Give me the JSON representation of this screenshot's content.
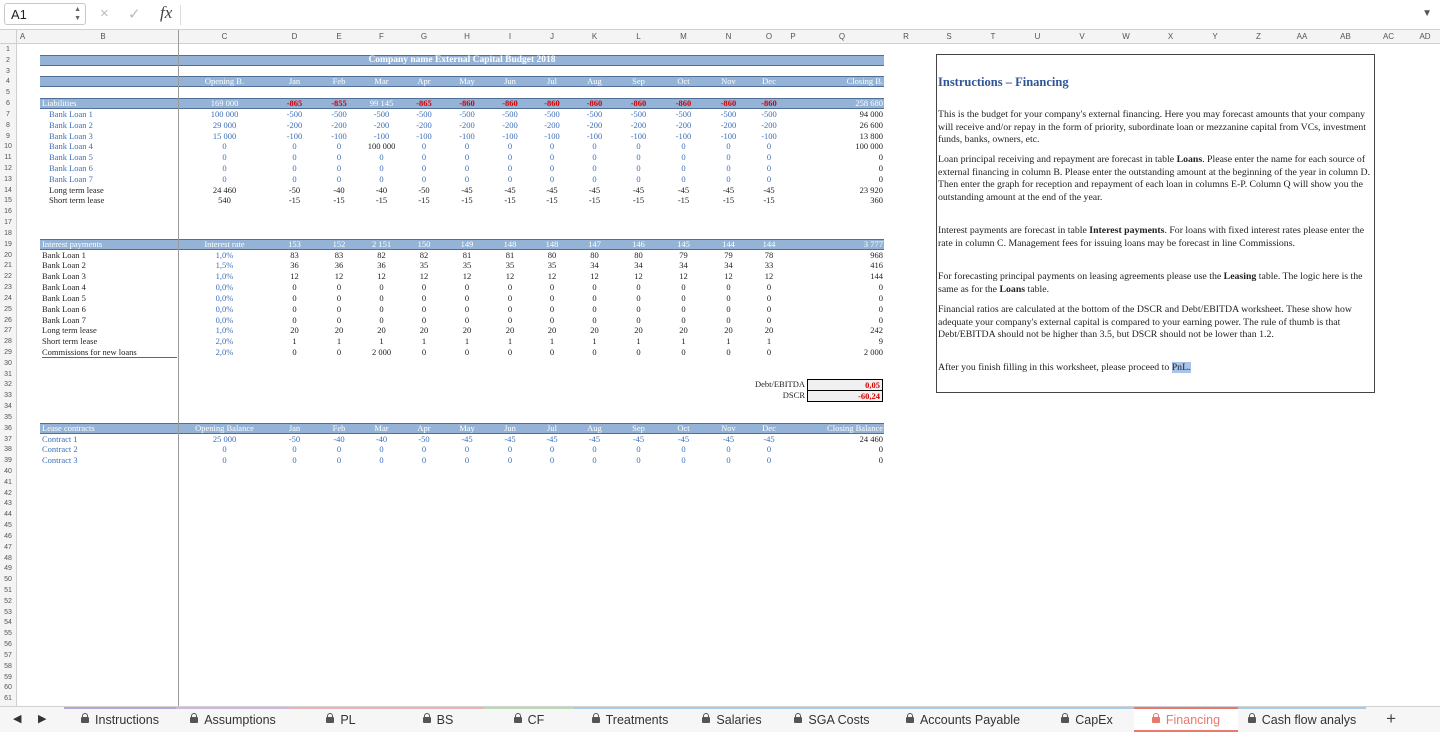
{
  "formula_bar": {
    "cell_ref": "A1",
    "cancel_icon": "×",
    "confirm_icon": "✓",
    "fx_label": "fx",
    "formula": ""
  },
  "columns": [
    "A",
    "B",
    "C",
    "D",
    "E",
    "F",
    "G",
    "H",
    "I",
    "J",
    "K",
    "L",
    "M",
    "N",
    "O",
    "P",
    "Q",
    "R",
    "S",
    "T",
    "U",
    "V",
    "W",
    "X",
    "Y",
    "Z",
    "AA",
    "AB",
    "AC",
    "AD"
  ],
  "rows": [
    "1",
    "2",
    "3",
    "4",
    "5",
    "6",
    "7",
    "8",
    "9",
    "10",
    "11",
    "12",
    "13",
    "14",
    "15",
    "16",
    "17",
    "18",
    "19",
    "20",
    "21",
    "22",
    "23",
    "24",
    "25",
    "26",
    "27",
    "28",
    "29",
    "30",
    "31",
    "32",
    "33",
    "34",
    "35",
    "36",
    "37",
    "38",
    "39",
    "40",
    "41",
    "42",
    "43",
    "44",
    "45",
    "46",
    "47",
    "48",
    "49",
    "50",
    "51",
    "52",
    "53",
    "54",
    "55",
    "56",
    "57",
    "58",
    "59",
    "60",
    "61"
  ],
  "title": "Company name External Capital Budget 2018",
  "months": [
    "Jan",
    "Feb",
    "Mar",
    "Apr",
    "May",
    "Jun",
    "Jul",
    "Aug",
    "Sep",
    "Oct",
    "Nov",
    "Dec"
  ],
  "liabilities": {
    "opening_label": "Opening B.",
    "closing_label": "Closing B.",
    "header": {
      "name": "Liabilities",
      "opening": "169 000",
      "months": [
        "-865",
        "-855",
        "99 145",
        "-865",
        "-860",
        "-860",
        "-860",
        "-860",
        "-860",
        "-860",
        "-860",
        "-860"
      ],
      "closing": "258 680"
    },
    "rows": [
      {
        "name": "Bank Loan 1",
        "opening": "100 000",
        "months": [
          "-500",
          "-500",
          "-500",
          "-500",
          "-500",
          "-500",
          "-500",
          "-500",
          "-500",
          "-500",
          "-500",
          "-500"
        ],
        "closing": "94 000"
      },
      {
        "name": "Bank Loan 2",
        "opening": "29 000",
        "months": [
          "-200",
          "-200",
          "-200",
          "-200",
          "-200",
          "-200",
          "-200",
          "-200",
          "-200",
          "-200",
          "-200",
          "-200"
        ],
        "closing": "26 600"
      },
      {
        "name": "Bank Loan 3",
        "opening": "15 000",
        "months": [
          "-100",
          "-100",
          "-100",
          "-100",
          "-100",
          "-100",
          "-100",
          "-100",
          "-100",
          "-100",
          "-100",
          "-100"
        ],
        "closing": "13 800"
      },
      {
        "name": "Bank Loan 4",
        "opening": "0",
        "months": [
          "0",
          "0",
          "100 000",
          "0",
          "0",
          "0",
          "0",
          "0",
          "0",
          "0",
          "0",
          "0"
        ],
        "closing": "100 000"
      },
      {
        "name": "Bank Loan 5",
        "opening": "0",
        "months": [
          "0",
          "0",
          "0",
          "0",
          "0",
          "0",
          "0",
          "0",
          "0",
          "0",
          "0",
          "0"
        ],
        "closing": "0"
      },
      {
        "name": "Bank Loan 6",
        "opening": "0",
        "months": [
          "0",
          "0",
          "0",
          "0",
          "0",
          "0",
          "0",
          "0",
          "0",
          "0",
          "0",
          "0"
        ],
        "closing": "0"
      },
      {
        "name": "Bank Loan 7",
        "opening": "0",
        "months": [
          "0",
          "0",
          "0",
          "0",
          "0",
          "0",
          "0",
          "0",
          "0",
          "0",
          "0",
          "0"
        ],
        "closing": "0"
      },
      {
        "name": "Long term lease",
        "opening": "24 460",
        "months": [
          "-50",
          "-40",
          "-40",
          "-50",
          "-45",
          "-45",
          "-45",
          "-45",
          "-45",
          "-45",
          "-45",
          "-45"
        ],
        "closing": "23 920"
      },
      {
        "name": "Short term lease",
        "opening": "540",
        "months": [
          "-15",
          "-15",
          "-15",
          "-15",
          "-15",
          "-15",
          "-15",
          "-15",
          "-15",
          "-15",
          "-15",
          "-15"
        ],
        "closing": "360"
      }
    ]
  },
  "interest": {
    "header": {
      "name": "Interest payments",
      "rate": "Interest rate",
      "months": [
        "153",
        "152",
        "2 151",
        "150",
        "149",
        "148",
        "148",
        "147",
        "146",
        "145",
        "144",
        "144"
      ],
      "closing": "3 777"
    },
    "rows": [
      {
        "name": "Bank Loan 1",
        "rate": "1,0%",
        "months": [
          "83",
          "83",
          "82",
          "82",
          "81",
          "81",
          "80",
          "80",
          "80",
          "79",
          "79",
          "78"
        ],
        "closing": "968"
      },
      {
        "name": "Bank Loan 2",
        "rate": "1,5%",
        "months": [
          "36",
          "36",
          "36",
          "35",
          "35",
          "35",
          "35",
          "34",
          "34",
          "34",
          "34",
          "33"
        ],
        "closing": "416"
      },
      {
        "name": "Bank Loan 3",
        "rate": "1,0%",
        "months": [
          "12",
          "12",
          "12",
          "12",
          "12",
          "12",
          "12",
          "12",
          "12",
          "12",
          "12",
          "12"
        ],
        "closing": "144"
      },
      {
        "name": "Bank Loan 4",
        "rate": "0,0%",
        "months": [
          "0",
          "0",
          "0",
          "0",
          "0",
          "0",
          "0",
          "0",
          "0",
          "0",
          "0",
          "0"
        ],
        "closing": "0"
      },
      {
        "name": "Bank Loan 5",
        "rate": "0,0%",
        "months": [
          "0",
          "0",
          "0",
          "0",
          "0",
          "0",
          "0",
          "0",
          "0",
          "0",
          "0",
          "0"
        ],
        "closing": "0"
      },
      {
        "name": "Bank Loan 6",
        "rate": "0,0%",
        "months": [
          "0",
          "0",
          "0",
          "0",
          "0",
          "0",
          "0",
          "0",
          "0",
          "0",
          "0",
          "0"
        ],
        "closing": "0"
      },
      {
        "name": "Bank Loan 7",
        "rate": "0,0%",
        "months": [
          "0",
          "0",
          "0",
          "0",
          "0",
          "0",
          "0",
          "0",
          "0",
          "0",
          "0",
          "0"
        ],
        "closing": "0"
      },
      {
        "name": "Long term lease",
        "rate": "1,0%",
        "months": [
          "20",
          "20",
          "20",
          "20",
          "20",
          "20",
          "20",
          "20",
          "20",
          "20",
          "20",
          "20"
        ],
        "closing": "242"
      },
      {
        "name": "Short term lease",
        "rate": "2,0%",
        "months": [
          "1",
          "1",
          "1",
          "1",
          "1",
          "1",
          "1",
          "1",
          "1",
          "1",
          "1",
          "1"
        ],
        "closing": "9"
      },
      {
        "name": "Commissions for new loans",
        "rate": "2,0%",
        "months": [
          "0",
          "0",
          "2 000",
          "0",
          "0",
          "0",
          "0",
          "0",
          "0",
          "0",
          "0",
          "0"
        ],
        "closing": "2 000"
      }
    ]
  },
  "ratios": [
    {
      "label": "Debt/EBITDA",
      "value": "0,05"
    },
    {
      "label": "DSCR",
      "value": "-60,24"
    }
  ],
  "lease": {
    "header": {
      "name": "Lease contracts",
      "opening": "Opening Balance",
      "closing": "Closing Balance"
    },
    "rows": [
      {
        "name": "Contract 1",
        "opening": "25 000",
        "months": [
          "-50",
          "-40",
          "-40",
          "-50",
          "-45",
          "-45",
          "-45",
          "-45",
          "-45",
          "-45",
          "-45",
          "-45"
        ],
        "closing": "24 460"
      },
      {
        "name": "Contract 2",
        "opening": "0",
        "months": [
          "0",
          "0",
          "0",
          "0",
          "0",
          "0",
          "0",
          "0",
          "0",
          "0",
          "0",
          "0"
        ],
        "closing": "0"
      },
      {
        "name": "Contract 3",
        "opening": "0",
        "months": [
          "0",
          "0",
          "0",
          "0",
          "0",
          "0",
          "0",
          "0",
          "0",
          "0",
          "0",
          "0"
        ],
        "closing": "0"
      }
    ]
  },
  "instructions": {
    "title": "Instructions – Financing",
    "p1": "This is the budget for your company's external financing. Here you may forecast amounts that your company will receive and/or repay in the form of priority, subordinate loan or mezzanine capital from VCs, investment funds, banks, owners, etc.",
    "p2a": "Loan principal receiving and repayment are forecast in table ",
    "p2b": "Loans",
    "p2c": ". Please enter the name for each source of external financing in column B. Please enter the outstanding amount at the beginning of the year in column D. Then enter the graph for reception and repayment of each loan in columns E-P. Column Q will show you the outstanding amount at the end of the year.",
    "p3a": "Interest payments are forecast in table ",
    "p3b": "Interest payments",
    "p3c": ". For loans with fixed interest rates please enter the rate in column C. Management fees for issuing loans may be forecast in line Commissions.",
    "p4a": "For forecasting principal payments on leasing agreements please use the ",
    "p4b": "Leasing",
    "p4c": " table. The logic here is the same as for the ",
    "p4d": "Loans",
    "p4e": " table.",
    "p5": "Financial ratios are calculated at the bottom of the DSCR and Debt/EBITDA worksheet. These show how adequate your company's external capital is compared to your earning power. The rule of thumb is that Debt/EBITDA should not be higher than 3.5, but DSCR should not be lower than 1.2.",
    "p6a": "After you finish filling in this worksheet, please proceed to ",
    "p6b": "PnL."
  },
  "tabs": [
    {
      "label": "Instructions",
      "color": "#b8a6d9"
    },
    {
      "label": "Assumptions",
      "color": "#cdb6e0"
    },
    {
      "label": "PL",
      "color": "#e8b4b8"
    },
    {
      "label": "BS",
      "color": "#e8b4b8"
    },
    {
      "label": "CF",
      "color": "#b7dcb0"
    },
    {
      "label": "Treatments",
      "color": "#a8cbe8"
    },
    {
      "label": "Salaries",
      "color": "#a8cbe8"
    },
    {
      "label": "SGA Costs",
      "color": "#a8cbe8"
    },
    {
      "label": "Accounts Payable",
      "color": "#a8cbe8"
    },
    {
      "label": "CapEx",
      "color": "#a8cbe8"
    },
    {
      "label": "Financing",
      "color": "#e8796f"
    },
    {
      "label": "Cash flow analys",
      "color": "#a8cbe8"
    }
  ],
  "active_tab": "Financing",
  "add_sheet_label": "+"
}
